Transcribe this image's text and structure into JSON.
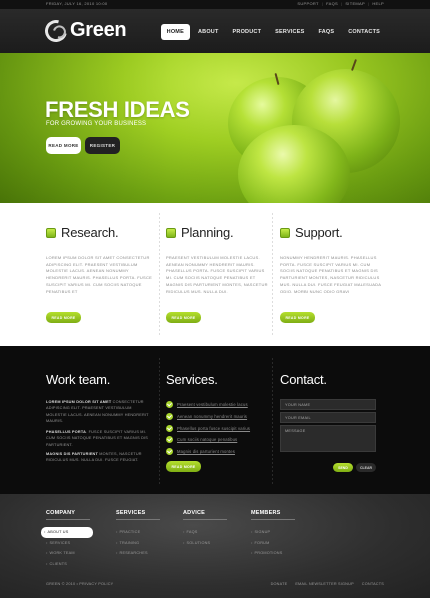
{
  "topbar": {
    "date": "FRIDAY, JULY 16, 2010 10:00",
    "links": [
      "SUPPORT",
      "FAQS",
      "SITEMAP",
      "HELP"
    ]
  },
  "header": {
    "logo": "Green",
    "nav": [
      "HOME",
      "ABOUT",
      "PRODUCT",
      "SERVICES",
      "FAQS",
      "CONTACTS"
    ]
  },
  "hero": {
    "title": "FRESH IDEAS",
    "subtitle": "FOR GROWING YOUR BUSINESS",
    "read_more": "READ MORE",
    "register": "REGISTER"
  },
  "features": [
    {
      "title": "Research.",
      "text": "LOREM IPSUM DOLOR SIT AMET CONSECTETUR ADIPISCING ELIT. PRAESENT VESTIBULUM MOLESTIE LACUS. AENEAN NONUMMY HENDRERIT MAURIS. PHASELLUS PORTA. FUSCE SUSCIPIT VARIUS MI. CUM SOCIIS NATOQUE PENATIBUS ET",
      "button": "READ MORE"
    },
    {
      "title": "Planning.",
      "text": "PRAESENT VESTIBULUM MOLESTIE LACUS. AENEAN NONUMMY HENDRERIT MAURIS. PHASELLUS PORTA. FUSCE SUSCIPIT VARIUS MI. CUM SOCIIS NATOQUE PENATIBUS ET MAGNIS DIS PARTURIENT MONTES, NASCETUR RIDICULUS MUS. NULLA DUI.",
      "button": "READ MORE"
    },
    {
      "title": "Support.",
      "text": "NONUMMY HENDRERIT MAURIS. PHASELLUS PORTA. FUSCE SUSCIPIT VARIUS MI. CUM SOCIIS NATOQUE PENATIBUS ET MAGNIS DIS PARTURIENT MONTES, NASCETUR RIDICULUS MUS. NULLA DUI. FUSCE FEUGIAT MALESUADA ODIO. MORBI NUNC ODIO GRAVI",
      "button": "READ MORE"
    }
  ],
  "work": {
    "title": "Work team.",
    "p1_lead": "LOREM IPSUM DOLOR SIT AMET",
    "p1_rest": " CONSECTETUR ADIPISCING ELIT. PRAESENT VESTIBULUM MOLESTIE LACUS. AENEAN NONUMMY HENDRERIT MAURIS.",
    "p2_lead": "PHASELLUS PORTA",
    "p2_rest": ". FUSCE SUSCIPIT VARIUS MI. CUM SOCIIS NATOQUE PENATIBUS ET MAGNIS DIS PARTURIENT.",
    "p3_lead": "MAGNIS DIS PARTURIENT",
    "p3_rest": " MONTES, NASCETUR RIDICULUS MUS. NULLA DUI. FUSCE FEUGIAT."
  },
  "services": {
    "title": "Services.",
    "items": [
      "Praesent vestibulum molestie lacus",
      "Aenean nonummy hendrerit mauris",
      "Phasellus porta fusce suscipit varius",
      "Cum sociis natoque penatibus",
      "Magnis dis parturient montes"
    ],
    "button": "READ MORE"
  },
  "contact": {
    "title": "Contact.",
    "name_placeholder": "YOUR NAME",
    "email_placeholder": "YOUR EMAIL",
    "message_placeholder": "MESSAGE",
    "send": "SEND",
    "clear": "CLEAR"
  },
  "footer": {
    "columns": [
      {
        "title": "COMPANY",
        "items": [
          "ABOUT US",
          "SERVICES",
          "WORK TEAM",
          "CLIENTS"
        ],
        "active": 0
      },
      {
        "title": "SERVICES",
        "items": [
          "PRACTICE",
          "TRAINING",
          "RESEARCHES"
        ],
        "active": -1
      },
      {
        "title": "ADVICE",
        "items": [
          "FAQS",
          "SOLUTIONS"
        ],
        "active": -1
      },
      {
        "title": "MEMBERS",
        "items": [
          "SIGNUP",
          "FORUM",
          "PROMOTIONS"
        ],
        "active": -1
      }
    ],
    "copyright": "GREEN © 2010 • PRIVACY POLICY",
    "links": [
      "DONATE",
      "EMAIL NEWSLETTER SIGNUP",
      "CONTACTS"
    ]
  },
  "colors": {
    "accent": "#9fcf22",
    "dark_bg": "#0c0c0c",
    "footer_bg": "#2e2e2e"
  }
}
